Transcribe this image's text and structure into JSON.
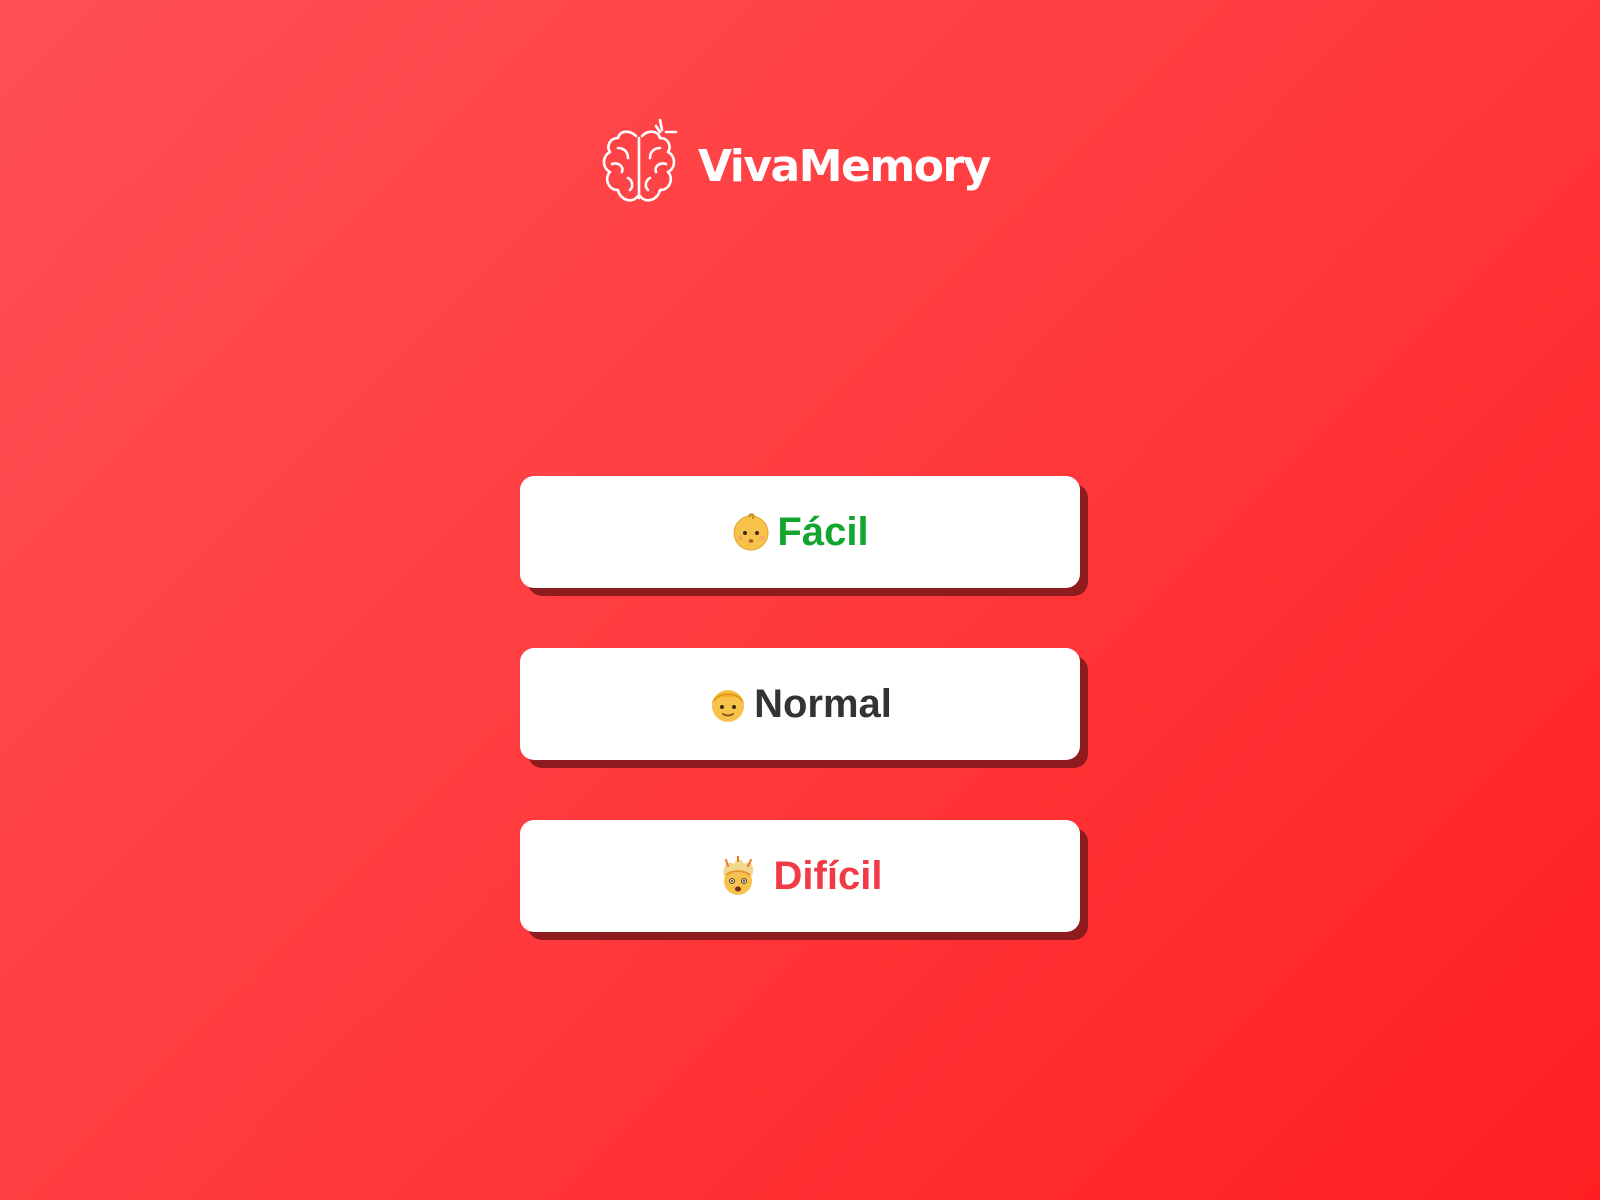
{
  "app": {
    "logo_text": "VivaMemory",
    "logo_icon": "brain-icon"
  },
  "levels": [
    {
      "label": "Fácil",
      "icon": "baby-face-icon",
      "color": "#14a52e"
    },
    {
      "label": "Normal",
      "icon": "boy-face-icon",
      "color": "#333333"
    },
    {
      "label": "Difícil",
      "icon": "exploding-head-icon",
      "color": "#f03a45"
    }
  ],
  "theme": {
    "background_start": "#ff5055",
    "background_end": "#ff1f22",
    "button_background": "#ffffff",
    "button_shadow": "#8e1b1e"
  }
}
